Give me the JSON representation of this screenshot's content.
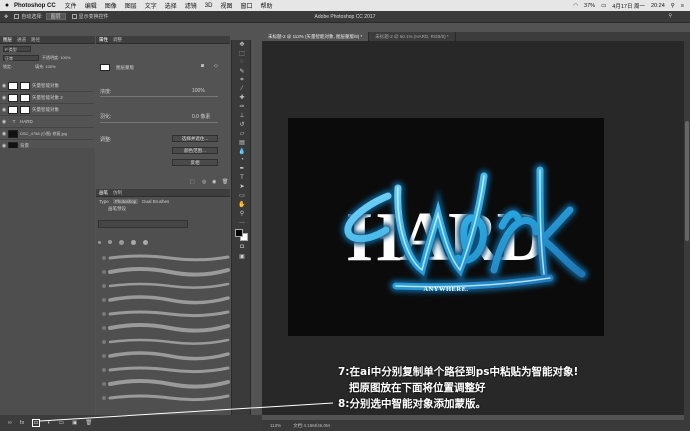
{
  "menubar": {
    "apple_icon": "apple-logo",
    "app": "Photoshop CC",
    "items": [
      "文件",
      "编辑",
      "图像",
      "图层",
      "文字",
      "选择",
      "滤镜",
      "3D",
      "视图",
      "窗口",
      "帮助"
    ],
    "battery": "37%",
    "date": "4月17日 周一",
    "time": "20:24"
  },
  "options": {
    "auto_select": "自动选择:",
    "auto_select_value": "图层",
    "show_transform": "显示变换控件",
    "window_title": "Adobe Photoshop CC 2017"
  },
  "layers_panel": {
    "tabs": [
      "图层",
      "通道",
      "路径"
    ],
    "kind": "P 类型",
    "blend": "正常",
    "opacity": "不透明度: 100%",
    "lock": "锁定:",
    "fill": "填充: 100%",
    "layers": [
      {
        "name": "矢量智能对象",
        "eye": "◉"
      },
      {
        "name": "矢量智能对象 2",
        "eye": "◉"
      },
      {
        "name": "矢量智能对象",
        "eye": "◉"
      },
      {
        "name": "HARD",
        "eye": "◉"
      },
      {
        "name": "DSC_4758 (小图) 修复.jpg",
        "eye": "◉"
      },
      {
        "name": "背景",
        "eye": "◉"
      }
    ]
  },
  "properties": {
    "tabs": [
      "属性",
      "调整"
    ],
    "mask_label": "图层蒙版",
    "density": "浓度:",
    "density_value": "100%",
    "feather": "羽化:",
    "feather_value": "0.0 像素",
    "refine": "调整:",
    "btn_select_mask": "选择并遮住...",
    "btn_color_range": "颜色范围...",
    "btn_invert": "反相"
  },
  "brushes": {
    "tabs": [
      "画笔",
      "仿制"
    ],
    "type_tabs": [
      "Type",
      "Photoshop",
      "Dual Brushes"
    ],
    "preset": "画笔预设"
  },
  "doctabs": [
    "未标题-2 @ 113% (矢量智能对象, 图层蒙版/8) *",
    "未标题-2 @ 60.1% (HARD, RGB/8) *"
  ],
  "artwork": {
    "word1": "HARD",
    "word2": "Work",
    "subtitle": "ANYWHERE."
  },
  "status": {
    "zoom": "113%",
    "doc": "文档:4.15M/46.0M"
  },
  "annotations": [
    "7:在ai中分别复制单个路径到ps中粘贴为智能对象!",
    "把原图放在下面将位置调整好",
    "8:分别选中智能对象添加蒙版。"
  ],
  "bottom_buttons": [
    "fx",
    "◘",
    "◐",
    "▭",
    "▣",
    "🗑"
  ]
}
